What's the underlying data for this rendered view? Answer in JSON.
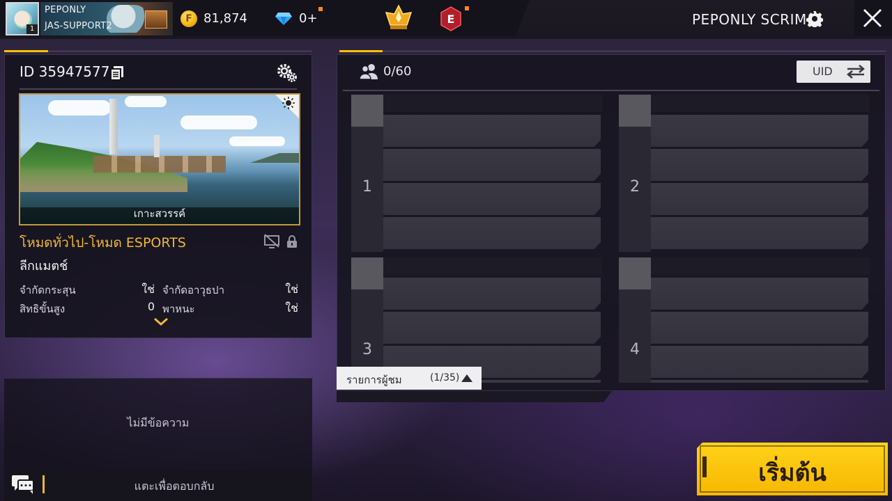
{
  "colors": {
    "accent_gold": "#f5c300",
    "mode_gold": "#f0b836",
    "panel_bg": "#16141e",
    "start_button": "#ffc20d",
    "notification_dot": "#ff8a1f"
  },
  "topbar": {
    "avatar_level": "1",
    "player_name": "PEPONLY",
    "player_guild": "JAS-SUPPORT2",
    "coins": "81,874",
    "coin_icon": "coin-icon",
    "coin_glyph": "F",
    "diamonds": "0+",
    "diamond_icon": "diamond-icon",
    "rank_icon": "rank-crown-icon",
    "e_icon": "esports-e-icon",
    "e_glyph": "E",
    "room_title": "PEPONLY SCRIM",
    "settings_icon": "gear-icon",
    "close_icon": "close-icon"
  },
  "room": {
    "id_label": "ID 35947577",
    "map_name": "เกาะสวรรค์",
    "mode_name": "โหมดทั่วไป-โหมด ESPORTS",
    "match_type": "ลีกแมตช์",
    "rules": [
      {
        "label": "จำกัดกระสุน",
        "value": "ใช่"
      },
      {
        "label": "จำกัดอาวุธปา",
        "value": "ใช่"
      },
      {
        "label": "สิทธิขั้นสูง",
        "value": "0"
      },
      {
        "label": "พาหนะ",
        "value": "ใช่"
      }
    ]
  },
  "chat": {
    "empty_text": "ไม่มีข้อความ",
    "placeholder": "แตะเพื่อตอบกลับ"
  },
  "teams": {
    "players_count": "0/60",
    "uid_label": "UID",
    "list": [
      {
        "number": "1"
      },
      {
        "number": "2"
      },
      {
        "number": "3"
      },
      {
        "number": "4"
      }
    ]
  },
  "spectators": {
    "label": "รายการผู้ชม",
    "count": "(1/35)"
  },
  "start_button": {
    "label": "เริ่มต้น"
  }
}
